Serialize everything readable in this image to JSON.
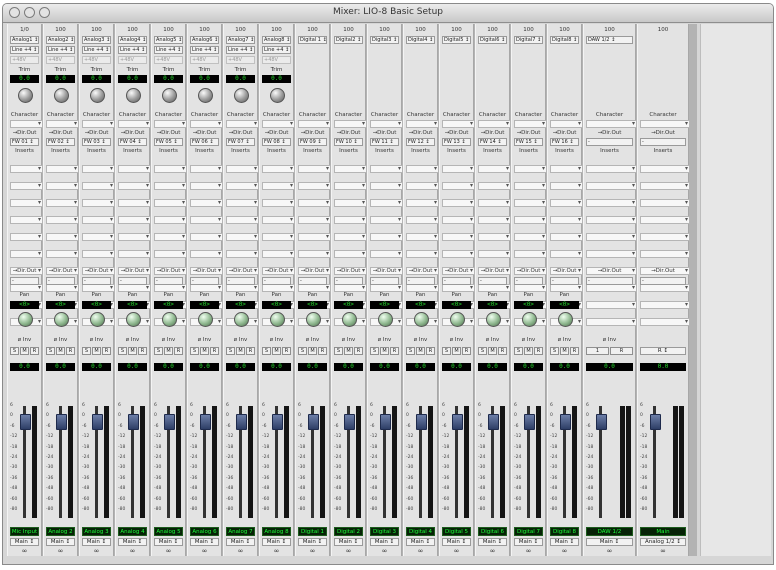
{
  "window": {
    "title": "Mixer: LIO-8 Basic Setup"
  },
  "labels": {
    "trim": "Trim",
    "character": "Character",
    "direct_out": "→Dir.Out",
    "inserts": "Inserts",
    "pan": "Pan",
    "phase_invert": "ø Inv",
    "solo": "S",
    "mute": "M",
    "record": "R",
    "link": "∞",
    "dash": "-",
    "zero": "0.0",
    "pan_center": "<0>"
  },
  "fader_scale": [
    "6",
    "0",
    "-6",
    "-12",
    "-18",
    "-24",
    "-30",
    "-36",
    "-48",
    "-60",
    "-80"
  ],
  "channels": [
    {
      "number": "1/0",
      "input": "Analog1 ↕",
      "level": "Line +4 ↕",
      "pad": "+48V",
      "direct_out": "FW 01 ↕",
      "name": "Mic Input",
      "output": "Main ↕",
      "has_trim": true
    },
    {
      "number": "100",
      "input": "Analog2 ↕",
      "level": "Line +4 ↕",
      "pad": "+48V",
      "direct_out": "FW 02 ↕",
      "name": "Analog 2",
      "output": "Main ↕",
      "has_trim": true
    },
    {
      "number": "100",
      "input": "Analog3 ↕",
      "level": "Line +4 ↕",
      "pad": "+48V",
      "direct_out": "FW 03 ↕",
      "name": "Analog 3",
      "output": "Main ↕",
      "has_trim": true
    },
    {
      "number": "100",
      "input": "Analog4 ↕",
      "level": "Line +4 ↕",
      "pad": "+48V",
      "direct_out": "FW 04 ↕",
      "name": "Analog 4",
      "output": "Main ↕",
      "has_trim": true
    },
    {
      "number": "100",
      "input": "Analog5 ↕",
      "level": "Line +4 ↕",
      "pad": "+48V",
      "direct_out": "FW 05 ↕",
      "name": "Analog 5",
      "output": "Main ↕",
      "has_trim": true
    },
    {
      "number": "100",
      "input": "Analog6 ↕",
      "level": "Line +4 ↕",
      "pad": "+48V",
      "direct_out": "FW 06 ↕",
      "name": "Analog 6",
      "output": "Main ↕",
      "has_trim": true
    },
    {
      "number": "100",
      "input": "Analog7 ↕",
      "level": "Line +4 ↕",
      "pad": "+48V",
      "direct_out": "FW 07 ↕",
      "name": "Analog 7",
      "output": "Main ↕",
      "has_trim": true
    },
    {
      "number": "100",
      "input": "Analog8 ↕",
      "level": "Line +4 ↕",
      "pad": "+48V",
      "direct_out": "FW 08 ↕",
      "name": "Analog 8",
      "output": "Main ↕",
      "has_trim": true
    },
    {
      "number": "100",
      "input": "Digital 1 ↕",
      "level": "",
      "pad": "",
      "direct_out": "FW 09 ↕",
      "name": "Digital 1",
      "output": "Main ↕",
      "has_trim": false
    },
    {
      "number": "100",
      "input": "Digital2 ↕",
      "level": "",
      "pad": "",
      "direct_out": "FW 10 ↕",
      "name": "Digital 2",
      "output": "Main ↕",
      "has_trim": false
    },
    {
      "number": "100",
      "input": "Digital3 ↕",
      "level": "",
      "pad": "",
      "direct_out": "FW 11 ↕",
      "name": "Digital 3",
      "output": "Main ↕",
      "has_trim": false
    },
    {
      "number": "100",
      "input": "Digital4 ↕",
      "level": "",
      "pad": "",
      "direct_out": "FW 12 ↕",
      "name": "Digital 4",
      "output": "Main ↕",
      "has_trim": false
    },
    {
      "number": "100",
      "input": "Digital5 ↕",
      "level": "",
      "pad": "",
      "direct_out": "FW 13 ↕",
      "name": "Digital 5",
      "output": "Main ↕",
      "has_trim": false
    },
    {
      "number": "100",
      "input": "Digital6 ↕",
      "level": "",
      "pad": "",
      "direct_out": "FW 14 ↕",
      "name": "Digital 6",
      "output": "Main ↕",
      "has_trim": false
    },
    {
      "number": "100",
      "input": "Digital7 ↕",
      "level": "",
      "pad": "",
      "direct_out": "FW 15 ↕",
      "name": "Digital 7",
      "output": "Main ↕",
      "has_trim": false
    },
    {
      "number": "100",
      "input": "Digital8 ↕",
      "level": "",
      "pad": "",
      "direct_out": "FW 16 ↕",
      "name": "Digital 8",
      "output": "Main ↕",
      "has_trim": false
    }
  ],
  "daw_strip": {
    "number": "100",
    "input": "DAW 1/2 ↕",
    "name": "DAW 1/2",
    "output": "Main ↕",
    "link_left": "1",
    "link_right": "R"
  },
  "main_strip": {
    "number": "100",
    "name": "Main",
    "output": "Analog 1/2 ↕",
    "select": "R ↕"
  },
  "colors": {
    "lcd_bg": "#000000",
    "lcd_text": "#22d82a",
    "fader_cap": "#4a5a86"
  }
}
